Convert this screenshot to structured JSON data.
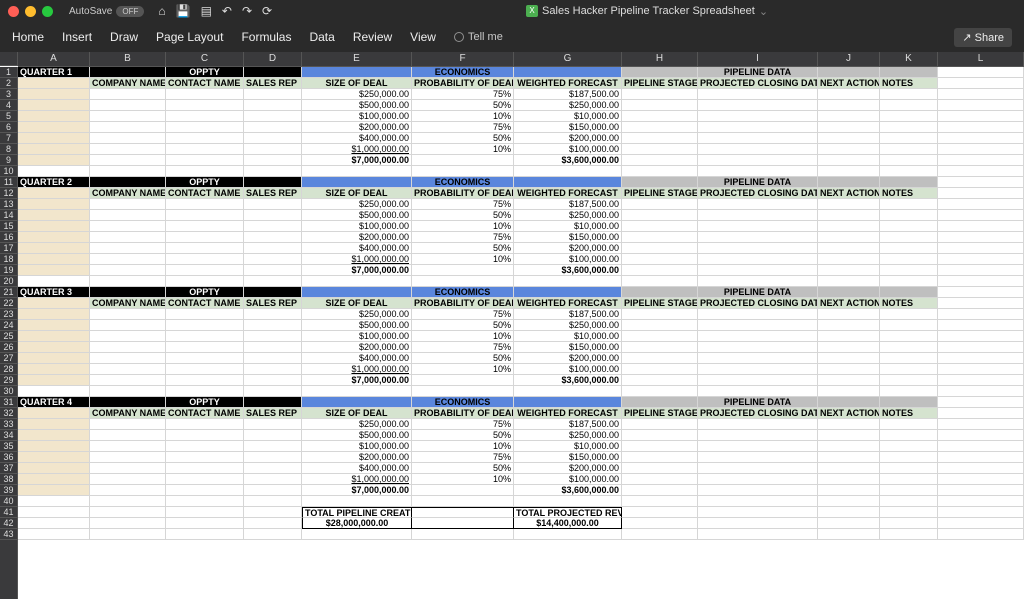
{
  "titlebar": {
    "autosave_label": "AutoSave",
    "autosave_state": "OFF",
    "doc_title": "Sales Hacker Pipeline Tracker Spreadsheet"
  },
  "ribbon": {
    "home": "Home",
    "insert": "Insert",
    "draw": "Draw",
    "page_layout": "Page Layout",
    "formulas": "Formulas",
    "data": "Data",
    "review": "Review",
    "view": "View",
    "tellme": "Tell me",
    "share": "Share"
  },
  "cols": [
    "A",
    "B",
    "C",
    "D",
    "E",
    "F",
    "G",
    "H",
    "I",
    "J",
    "K",
    "L"
  ],
  "section_headers": {
    "oppty": "OPPTY",
    "economics": "ECONOMICS",
    "pipeline": "PIPELINE DATA"
  },
  "col_headers": {
    "company": "COMPANY NAME",
    "contact": "CONTACT NAME",
    "rep": "SALES REP",
    "size": "SIZE OF DEAL",
    "prob": "PROBABILITY OF DEAL",
    "wf": "WEIGHTED FORECAST",
    "stage": "PIPELINE STAGE",
    "close": "PROJECTED CLOSING DATE",
    "next": "NEXT ACTION",
    "notes": "NOTES"
  },
  "quarters": [
    {
      "label": "QUARTER 1",
      "rows": [
        {
          "size": "$250,000.00",
          "p": "75%",
          "wf": "$187,500.00"
        },
        {
          "size": "$500,000.00",
          "p": "50%",
          "wf": "$250,000.00"
        },
        {
          "size": "$100,000.00",
          "p": "10%",
          "wf": "$10,000.00"
        },
        {
          "size": "$200,000.00",
          "p": "75%",
          "wf": "$150,000.00"
        },
        {
          "size": "$400,000.00",
          "p": "50%",
          "wf": "$200,000.00"
        },
        {
          "size": "$1,000,000.00",
          "p": "10%",
          "wf": "$100,000.00"
        }
      ],
      "total_size": "$7,000,000.00",
      "total_wf": "$3,600,000.00"
    },
    {
      "label": "QUARTER 2",
      "rows": [
        {
          "size": "$250,000.00",
          "p": "75%",
          "wf": "$187,500.00"
        },
        {
          "size": "$500,000.00",
          "p": "50%",
          "wf": "$250,000.00"
        },
        {
          "size": "$100,000.00",
          "p": "10%",
          "wf": "$10,000.00"
        },
        {
          "size": "$200,000.00",
          "p": "75%",
          "wf": "$150,000.00"
        },
        {
          "size": "$400,000.00",
          "p": "50%",
          "wf": "$200,000.00"
        },
        {
          "size": "$1,000,000.00",
          "p": "10%",
          "wf": "$100,000.00"
        }
      ],
      "total_size": "$7,000,000.00",
      "total_wf": "$3,600,000.00"
    },
    {
      "label": "QUARTER 3",
      "rows": [
        {
          "size": "$250,000.00",
          "p": "75%",
          "wf": "$187,500.00"
        },
        {
          "size": "$500,000.00",
          "p": "50%",
          "wf": "$250,000.00"
        },
        {
          "size": "$100,000.00",
          "p": "10%",
          "wf": "$10,000.00"
        },
        {
          "size": "$200,000.00",
          "p": "75%",
          "wf": "$150,000.00"
        },
        {
          "size": "$400,000.00",
          "p": "50%",
          "wf": "$200,000.00"
        },
        {
          "size": "$1,000,000.00",
          "p": "10%",
          "wf": "$100,000.00"
        }
      ],
      "total_size": "$7,000,000.00",
      "total_wf": "$3,600,000.00"
    },
    {
      "label": "QUARTER 4",
      "rows": [
        {
          "size": "$250,000.00",
          "p": "75%",
          "wf": "$187,500.00"
        },
        {
          "size": "$500,000.00",
          "p": "50%",
          "wf": "$250,000.00"
        },
        {
          "size": "$100,000.00",
          "p": "10%",
          "wf": "$10,000.00"
        },
        {
          "size": "$200,000.00",
          "p": "75%",
          "wf": "$150,000.00"
        },
        {
          "size": "$400,000.00",
          "p": "50%",
          "wf": "$200,000.00"
        },
        {
          "size": "$1,000,000.00",
          "p": "10%",
          "wf": "$100,000.00"
        }
      ],
      "total_size": "$7,000,000.00",
      "total_wf": "$3,600,000.00"
    }
  ],
  "footer": {
    "created_label": "TOTAL PIPELINE CREATED",
    "created_value": "$28,000,000.00",
    "revenue_label": "TOTAL PROJECTED REVENUE",
    "revenue_value": "$14,400,000.00"
  },
  "chart_data": {
    "type": "table",
    "title": "Sales Hacker Pipeline Tracker",
    "series": [
      {
        "name": "Size of Deal",
        "values": [
          250000,
          500000,
          100000,
          200000,
          400000,
          1000000
        ]
      },
      {
        "name": "Probability",
        "values": [
          0.75,
          0.5,
          0.1,
          0.75,
          0.5,
          0.1
        ]
      },
      {
        "name": "Weighted Forecast",
        "values": [
          187500,
          250000,
          10000,
          150000,
          200000,
          100000
        ]
      }
    ],
    "quarter_totals": {
      "size": 7000000,
      "weighted": 3600000
    },
    "grand_totals": {
      "pipeline_created": 28000000,
      "projected_revenue": 14400000
    }
  }
}
